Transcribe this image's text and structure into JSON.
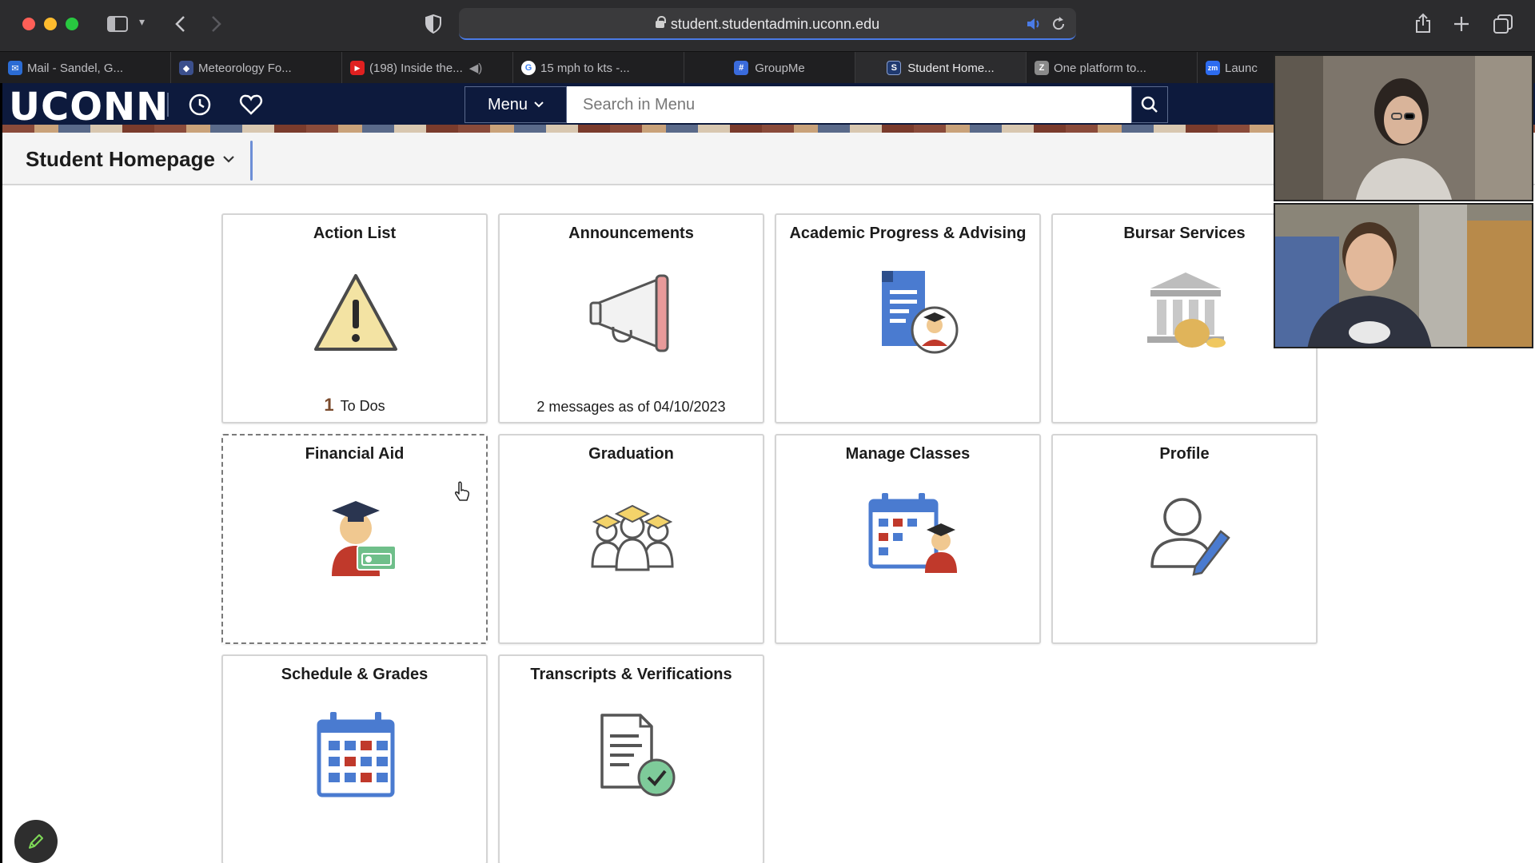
{
  "browser": {
    "url": "student.studentadmin.uconn.edu",
    "tabs": [
      {
        "label": "Mail - Sandel, G...",
        "fav_color": "#2b6cd4",
        "fav_glyph": "✉"
      },
      {
        "label": "Meteorology Fo...",
        "fav_color": "#3b4f8c",
        "fav_glyph": "◆"
      },
      {
        "label": "(198) Inside the...",
        "fav_color": "#e02020",
        "fav_glyph": "▶"
      },
      {
        "label": "15 mph to kts -...",
        "fav_color": "#ffffff",
        "fav_glyph": "G"
      },
      {
        "label": "GroupMe",
        "fav_color": "#3a6bdc",
        "fav_glyph": "#"
      },
      {
        "label": "Student Home...",
        "fav_color": "#203a70",
        "fav_glyph": "S"
      },
      {
        "label": "One platform to...",
        "fav_color": "#8a8a8a",
        "fav_glyph": "Z"
      },
      {
        "label": "Launc",
        "fav_color": "#2d6cf0",
        "fav_glyph": "zm"
      }
    ]
  },
  "header": {
    "logo": "UCONN",
    "menu_label": "Menu",
    "search_placeholder": "Search in Menu"
  },
  "page": {
    "title": "Student Homepage"
  },
  "tiles": [
    {
      "title": "Action List",
      "icon": "warning-icon",
      "count": "1",
      "foot": "To Dos"
    },
    {
      "title": "Announcements",
      "icon": "megaphone-icon",
      "foot": "2 messages as of 04/10/2023"
    },
    {
      "title": "Academic Progress & Advising",
      "icon": "document-advisor-icon"
    },
    {
      "title": "Bursar Services",
      "icon": "bank-icon"
    },
    {
      "title": "Financial Aid",
      "icon": "graduate-money-icon"
    },
    {
      "title": "Graduation",
      "icon": "graduates-icon"
    },
    {
      "title": "Manage Classes",
      "icon": "calendar-student-icon"
    },
    {
      "title": "Profile",
      "icon": "user-edit-icon"
    },
    {
      "title": "Schedule & Grades",
      "icon": "calendar-icon"
    },
    {
      "title": "Transcripts & Verifications",
      "icon": "document-check-icon"
    }
  ],
  "colors": {
    "header_bg": "#0d1a3d",
    "accent_blue": "#4a7be6",
    "warning_yellow": "#f3e3a3",
    "advisor_red": "#c0392b"
  }
}
